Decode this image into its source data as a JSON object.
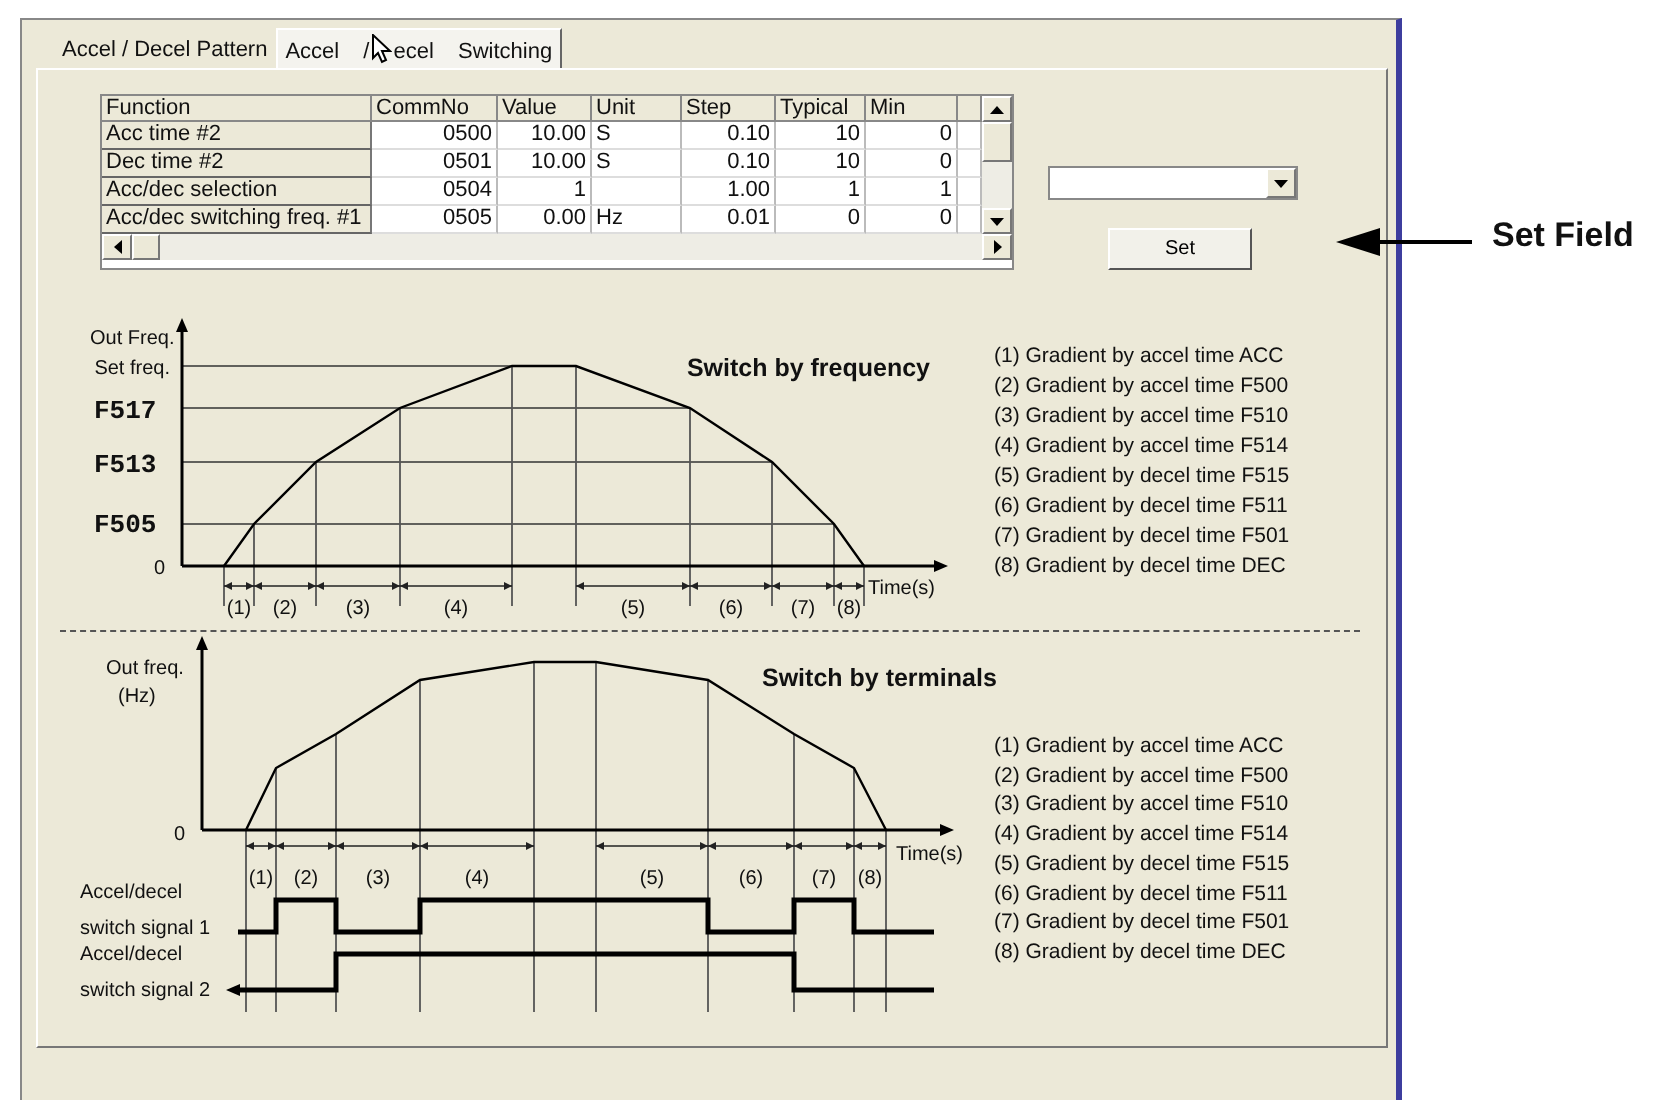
{
  "tabs": [
    {
      "label": "Accel / Decel Pattern",
      "selected": false
    },
    {
      "label": "Accel / ecel Switching",
      "selected": true
    }
  ],
  "table": {
    "columns": [
      "Function",
      "CommNo",
      "Value",
      "Unit",
      "Step",
      "Typical",
      "Min"
    ],
    "rows": [
      {
        "cells": [
          "Acc time #2",
          "0500",
          "10.00",
          "S",
          "0.10",
          "10",
          "0"
        ]
      },
      {
        "cells": [
          "Dec time #2",
          "0501",
          "10.00",
          "S",
          "0.10",
          "10",
          "0"
        ]
      },
      {
        "cells": [
          "Acc/dec selection",
          "0504",
          "1",
          "",
          "1.00",
          "1",
          "1"
        ]
      },
      {
        "cells": [
          "Acc/dec switching freq. #1",
          "0505",
          "0.00",
          "Hz",
          "0.01",
          "0",
          "0"
        ]
      }
    ]
  },
  "set_button": "Set",
  "frequency_chart": {
    "title": "Switch by frequency",
    "axis_title": "Out Freq.",
    "levels": [
      {
        "text": "Set freq.",
        "kind": "plain"
      },
      {
        "text": "F517",
        "kind": "code"
      },
      {
        "text": "F513",
        "kind": "code"
      },
      {
        "text": "F505",
        "kind": "code"
      }
    ],
    "zero": "0",
    "x_label": "Time(s)",
    "segments": [
      "(1)",
      "(2)",
      "(3)",
      "(4)",
      "(5)",
      "(6)",
      "(7)",
      "(8)"
    ],
    "legend": [
      "(1) Gradient by accel time ACC",
      "(2) Gradient by accel time F500",
      "(3) Gradient by accel time F510",
      "(4) Gradient by accel time F514",
      "(5) Gradient by decel time F515",
      "(6) Gradient by decel time F511",
      "(7) Gradient by decel time F501",
      "(8) Gradient by decel time DEC"
    ]
  },
  "terminal_chart": {
    "title": "Switch by terminals",
    "axis_title": "Out freq.",
    "axis_unit": "(Hz)",
    "zero": "0",
    "x_label": "Time(s)",
    "segments": [
      "(1)",
      "(2)",
      "(3)",
      "(4)",
      "(5)",
      "(6)",
      "(7)",
      "(8)"
    ],
    "signals": [
      {
        "label": [
          "Accel/decel",
          "switch signal 1"
        ]
      },
      {
        "label": [
          "Accel/decel",
          "switch signal 2"
        ]
      }
    ],
    "legend": [
      "(1) Gradient by accel time ACC",
      "(2) Gradient by accel time F500",
      "(3) Gradient by accel time F510",
      "(4) Gradient by accel time F514",
      "(5) Gradient by decel time F515",
      "(6) Gradient by decel time F511",
      "(7) Gradient by decel time F501",
      "(8) Gradient by decel time DEC"
    ]
  },
  "callout": {
    "label": "Set Field"
  }
}
